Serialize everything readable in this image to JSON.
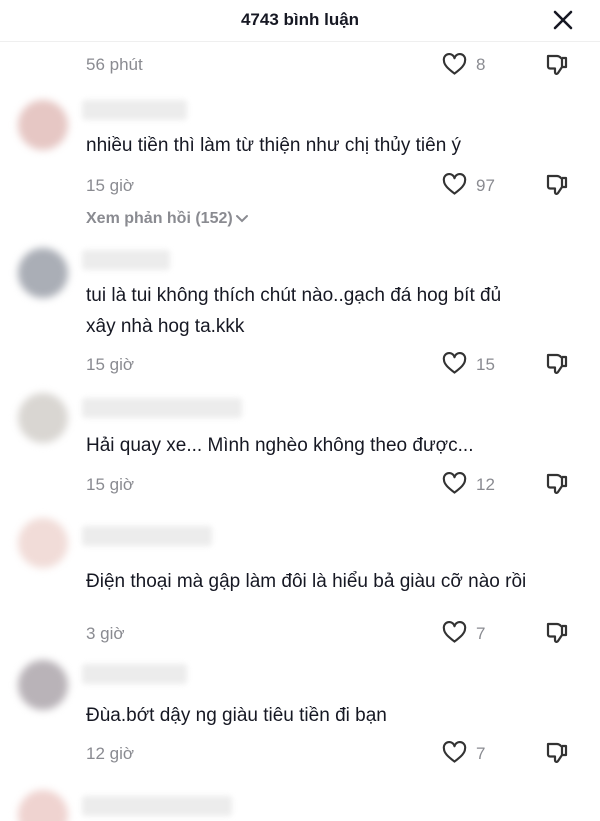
{
  "header": {
    "title": "4743 bình luận"
  },
  "top_partial": {
    "time": "56 phút",
    "likes": "8"
  },
  "comments": [
    {
      "text": "nhiều tiền thì làm từ thiện như chị thủy tiên ý",
      "time": "15 giờ",
      "likes": "97",
      "replies": "Xem phản hồi (152)"
    },
    {
      "text": "tui là tui không thích chút nào..gạch đá hog bít đủ xây nhà hog ta.kkk",
      "time": "15 giờ",
      "likes": "15"
    },
    {
      "text": "Hải quay xe... Mình nghèo không theo được...",
      "time": "15 giờ",
      "likes": "12"
    },
    {
      "text": "Điện thoại mà gập làm đôi là hiểu bả giàu cỡ nào rồi",
      "time": "3 giờ",
      "likes": "7"
    },
    {
      "text": "Đùa.bớt dậy ng giàu tiêu tiền đi bạn",
      "time": "12 giờ",
      "likes": "7"
    }
  ],
  "icons": {
    "close": "close-icon",
    "like": "heart-outline-icon",
    "dislike": "thumbs-down-icon",
    "expand": "chevron-down-icon"
  }
}
